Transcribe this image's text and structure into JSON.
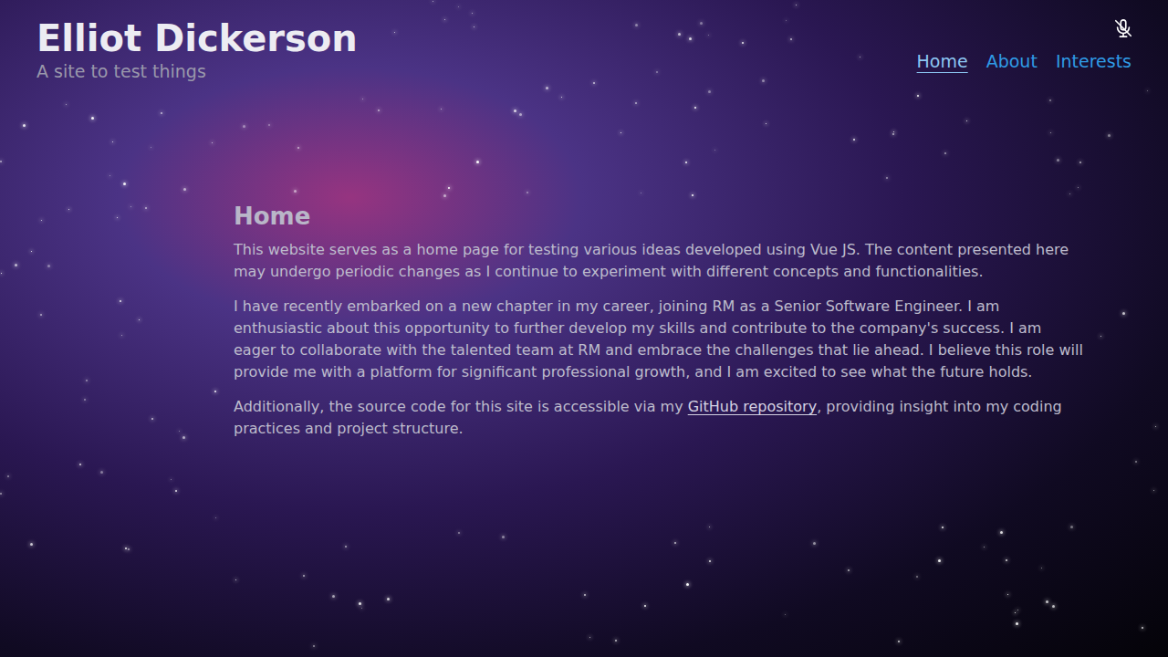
{
  "header": {
    "title": "Elliot Dickerson",
    "subtitle": "A site to test things"
  },
  "microphone": {
    "muted": true
  },
  "nav": [
    {
      "label": "Home",
      "selected": true
    },
    {
      "label": "About",
      "selected": false
    },
    {
      "label": "Interests",
      "selected": false
    }
  ],
  "main": {
    "heading": "Home",
    "paragraphs": [
      {
        "segments": [
          {
            "kind": "text",
            "text": "This website serves as a home page for testing various ideas developed using Vue JS. The content presented here may undergo periodic changes as I continue to experiment with different concepts and functionalities."
          }
        ]
      },
      {
        "segments": [
          {
            "kind": "text",
            "text": "I have recently embarked on a new chapter in my career, joining RM as a Senior Software Engineer. I am enthusiastic about this opportunity to further develop my skills and contribute to the company's success. I am eager to collaborate with the talented team at RM and embrace the challenges that lie ahead. I believe this role will provide me with a platform for significant professional growth, and I am excited to see what the future holds."
          }
        ]
      },
      {
        "segments": [
          {
            "kind": "text",
            "text": "Additionally, the source code for this site is accessible via my "
          },
          {
            "kind": "link",
            "text": "GitHub repository"
          },
          {
            "kind": "text",
            "text": ", providing insight into my coding practices and project structure."
          }
        ]
      }
    ]
  }
}
